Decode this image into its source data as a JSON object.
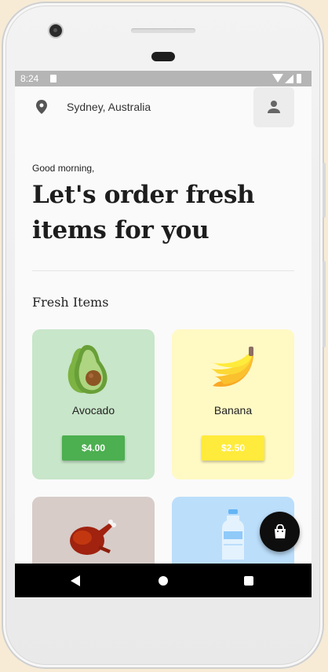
{
  "status_bar": {
    "time": "8:24"
  },
  "header": {
    "location": "Sydney, Australia"
  },
  "greeting": "Good morning,",
  "headline": "Let's order fresh items for you",
  "section_title": "Fresh Items",
  "items": [
    {
      "name": "Avocado",
      "price": "$4.00",
      "bg": "#c8e6c9",
      "button_color": "#4caf50",
      "icon": "avocado-icon"
    },
    {
      "name": "Banana",
      "price": "$2.50",
      "bg": "#fff9c4",
      "button_color": "#ffeb3b",
      "icon": "banana-icon"
    },
    {
      "name": "",
      "price": "",
      "bg": "#d7ccc8",
      "button_color": "#795548",
      "icon": "chicken-icon"
    },
    {
      "name": "",
      "price": "",
      "bg": "#bbdefb",
      "button_color": "#2196f3",
      "icon": "water-bottle-icon"
    }
  ],
  "icons": {
    "location": "location-pin-icon",
    "profile": "person-icon",
    "cart": "shopping-bag-icon"
  }
}
